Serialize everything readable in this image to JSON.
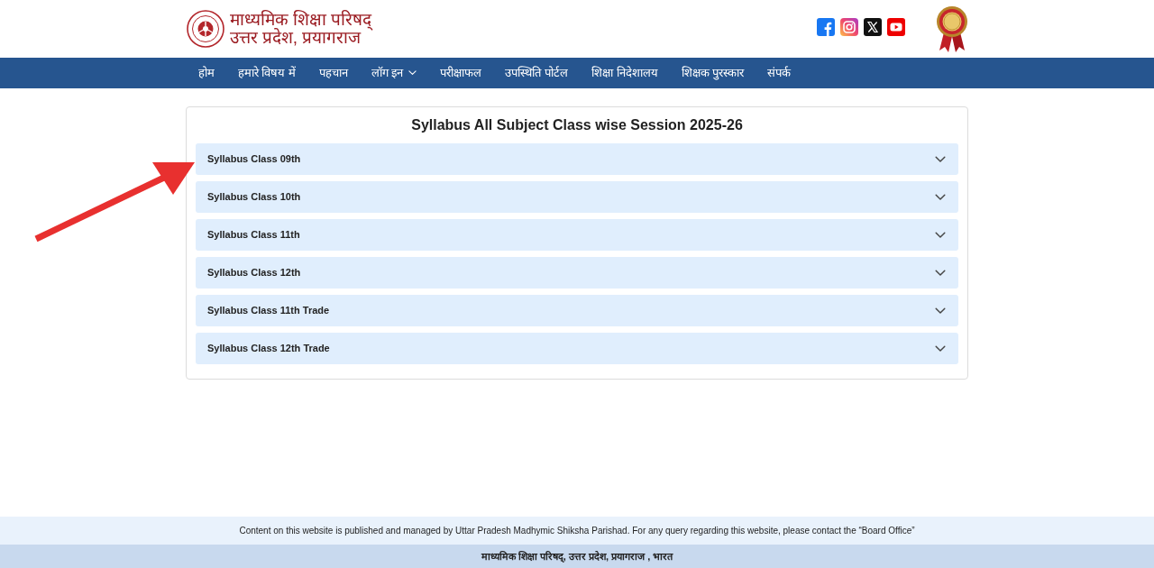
{
  "header": {
    "logo": {
      "line_1": "माध्यमिक शिक्षा परिषद्",
      "line_2": "उत्तर प्रदेश, प्रयागराज"
    },
    "social": [
      {
        "kind": "facebook"
      },
      {
        "kind": "instagram"
      },
      {
        "kind": "x"
      },
      {
        "kind": "youtube"
      }
    ]
  },
  "nav": {
    "items": [
      {
        "label": "होम",
        "kind": "link"
      },
      {
        "label": "हमारे विषय में",
        "kind": "link"
      },
      {
        "label": "पहचान",
        "kind": "link"
      },
      {
        "label": "लॉग इन",
        "kind": "dropdown"
      },
      {
        "label": "परीक्षाफल",
        "kind": "link"
      },
      {
        "label": "उपस्थिति पोर्टल",
        "kind": "link"
      },
      {
        "label": "शिक्षा निदेशालय",
        "kind": "link"
      },
      {
        "label": "शिक्षक पुरस्कार",
        "kind": "link"
      },
      {
        "label": "संपर्क",
        "kind": "link"
      }
    ]
  },
  "card": {
    "title": "Syllabus All Subject Class wise Session 2025-26",
    "accordion": [
      {
        "label": "Syllabus Class 09th",
        "expanded": false
      },
      {
        "label": "Syllabus Class 10th",
        "expanded": false
      },
      {
        "label": "Syllabus Class 11th",
        "expanded": false
      },
      {
        "label": "Syllabus Class 12th",
        "expanded": false
      },
      {
        "label": "Syllabus Class 11th Trade",
        "expanded": false
      },
      {
        "label": "Syllabus Class 12th Trade",
        "expanded": false
      }
    ]
  },
  "footer": {
    "notice": "Content on this website is published and managed by Uttar Pradesh Madhymic Shiksha Parishad. For any query regarding this website, please contact the “Board Office”",
    "address": "माध्यमिक शिक्षा परिषद्, उत्तर प्रदेश, प्रयागराज , भारत"
  }
}
